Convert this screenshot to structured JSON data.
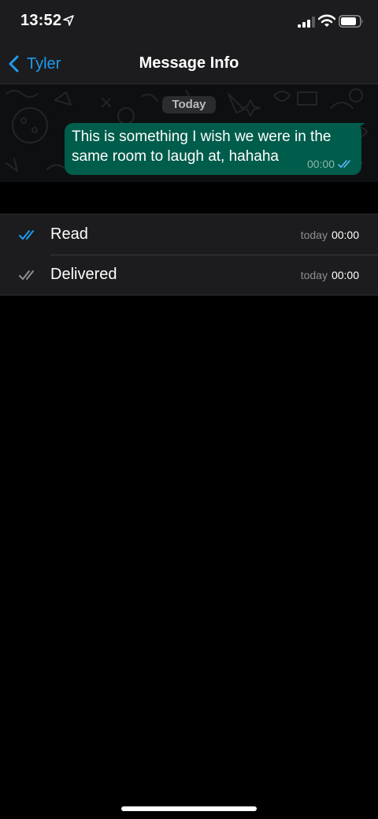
{
  "status_bar": {
    "time": "13:52",
    "icons": [
      "location-arrow-icon",
      "cellular-signal-icon",
      "wifi-icon",
      "battery-icon"
    ]
  },
  "nav": {
    "back_label": "Tyler",
    "title": "Message Info"
  },
  "chat": {
    "date_label": "Today",
    "message": {
      "text": "This is something I wish we were in the same room to laugh at, hahaha",
      "time": "00:00",
      "status_icon": "double-check-read-icon"
    }
  },
  "receipts": [
    {
      "label": "Read",
      "day": "today",
      "time": "00:00",
      "icon": "double-check-read-icon",
      "icon_color": "#1e9bf0"
    },
    {
      "label": "Delivered",
      "day": "today",
      "time": "00:00",
      "icon": "double-check-delivered-icon",
      "icon_color": "#8e8e93"
    }
  ],
  "colors": {
    "accent": "#1e9bf0",
    "bubble": "#005c4b",
    "background": "#000000",
    "surface": "#1c1c1e"
  }
}
